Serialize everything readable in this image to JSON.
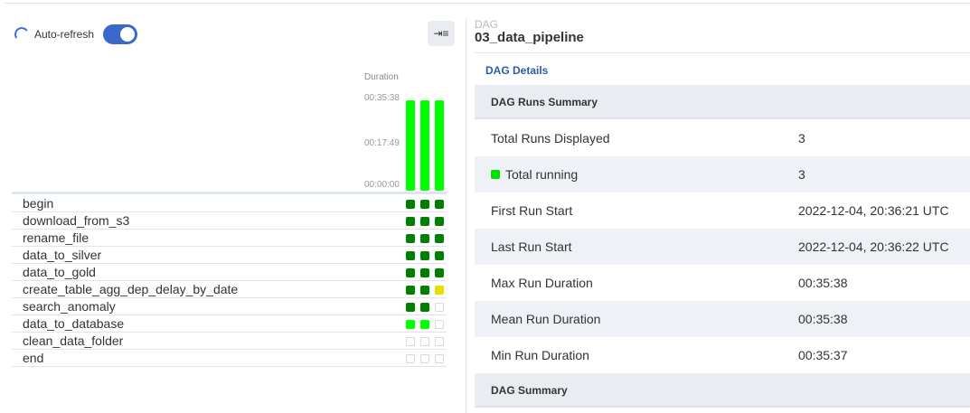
{
  "toolbar": {
    "auto_refresh_label": "Auto-refresh",
    "auto_refresh_on": true,
    "collapse_icon": "collapse-panel-icon"
  },
  "duration_chart": {
    "title": "Duration",
    "ticks": [
      "00:35:38",
      "00:17:49",
      "00:00:00"
    ],
    "runs": [
      {
        "duration": "00:35:38",
        "fraction": 1.0,
        "state": "running"
      },
      {
        "duration": "00:35:38",
        "fraction": 1.0,
        "state": "running"
      },
      {
        "duration": "00:35:37",
        "fraction": 1.0,
        "state": "running"
      }
    ]
  },
  "tasks": [
    {
      "name": "begin",
      "states": [
        "success",
        "success",
        "success"
      ]
    },
    {
      "name": "download_from_s3",
      "states": [
        "success",
        "success",
        "success"
      ]
    },
    {
      "name": "rename_file",
      "states": [
        "success",
        "success",
        "success"
      ]
    },
    {
      "name": "data_to_silver",
      "states": [
        "success",
        "success",
        "success"
      ]
    },
    {
      "name": "data_to_gold",
      "states": [
        "success",
        "success",
        "success"
      ]
    },
    {
      "name": "create_table_agg_dep_delay_by_date",
      "states": [
        "success",
        "success",
        "queued"
      ]
    },
    {
      "name": "search_anomaly",
      "states": [
        "success",
        "success",
        "none"
      ]
    },
    {
      "name": "data_to_database",
      "states": [
        "running",
        "running",
        "none"
      ]
    },
    {
      "name": "clean_data_folder",
      "states": [
        "none",
        "none",
        "none"
      ]
    },
    {
      "name": "end",
      "states": [
        "none",
        "none",
        "none"
      ]
    }
  ],
  "colors": {
    "success": "#008000",
    "running": "#00ff00",
    "queued": "#e5e000",
    "accent": "#3a69c9"
  },
  "details": {
    "dag_label": "DAG",
    "dag_id": "03_data_pipeline",
    "tab": "DAG Details",
    "runs_summary_title": "DAG Runs Summary",
    "rows": [
      {
        "key": "Total Runs Displayed",
        "value": "3"
      },
      {
        "key": "Total running",
        "value": "3",
        "dot": true
      },
      {
        "key": "First Run Start",
        "value": "2022-12-04, 20:36:21 UTC"
      },
      {
        "key": "Last Run Start",
        "value": "2022-12-04, 20:36:22 UTC"
      },
      {
        "key": "Max Run Duration",
        "value": "00:35:38"
      },
      {
        "key": "Mean Run Duration",
        "value": "00:35:38"
      },
      {
        "key": "Min Run Duration",
        "value": "00:35:37"
      }
    ],
    "dag_summary_title": "DAG Summary"
  }
}
